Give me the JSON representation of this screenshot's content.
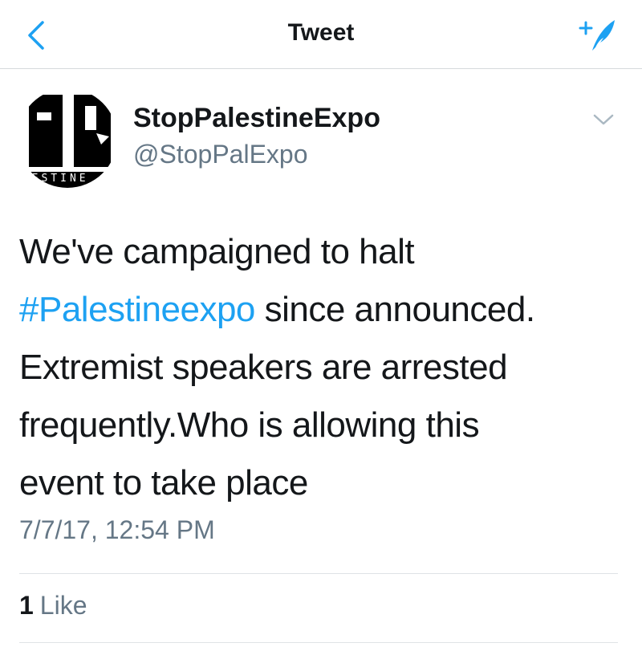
{
  "nav": {
    "title": "Tweet",
    "back_icon": "chevron-left-icon",
    "compose_icon": "compose-tweet-icon",
    "accent_color": "#1da1f2"
  },
  "author": {
    "display_name": "StopPalestineExpo",
    "handle": "@StopPalExpo",
    "avatar_text": "ALESTINE"
  },
  "tweet": {
    "lines": [
      {
        "before": "We've campaigned to halt",
        "hashtag": "",
        "after": ""
      },
      {
        "before": "",
        "hashtag": "#Palestineexpo",
        "after": " since announced."
      },
      {
        "before": "Extremist speakers are arrested",
        "hashtag": "",
        "after": ""
      },
      {
        "before": "frequently.Who is allowing this",
        "hashtag": "",
        "after": ""
      },
      {
        "before": "event to take place",
        "hashtag": "",
        "after": ""
      }
    ],
    "timestamp": "7/7/17, 12:54 PM"
  },
  "stats": {
    "likes_count": "1",
    "likes_label": "Like"
  }
}
